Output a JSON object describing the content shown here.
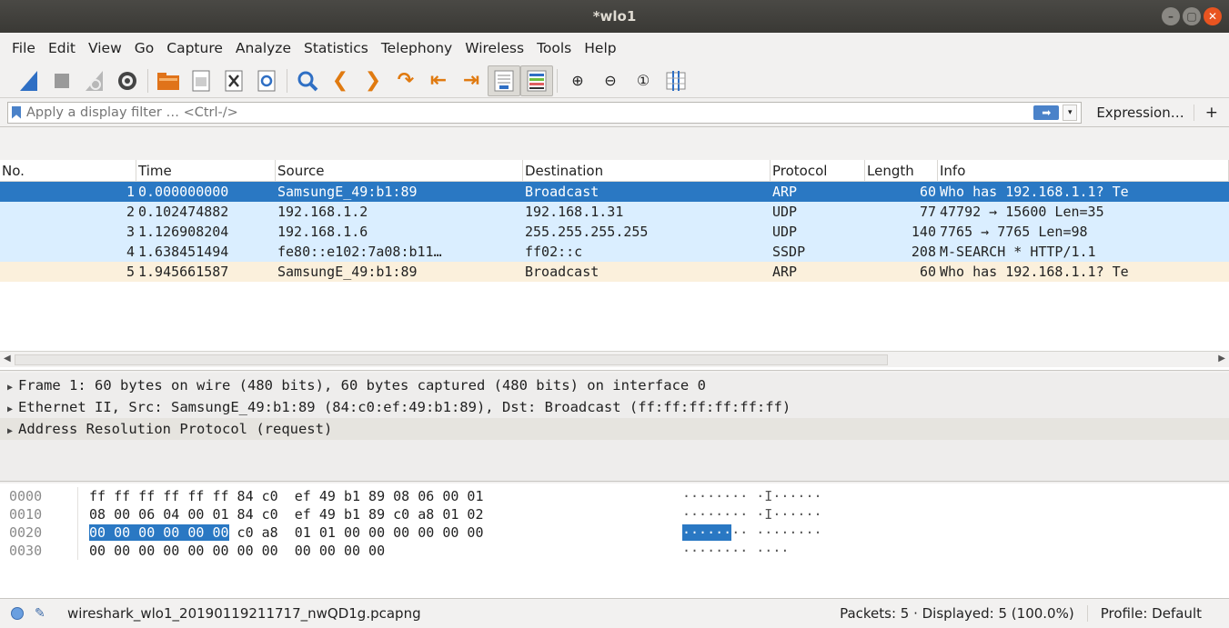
{
  "window": {
    "title": "*wlo1"
  },
  "menu": [
    {
      "label": "File"
    },
    {
      "label": "Edit"
    },
    {
      "label": "View"
    },
    {
      "label": "Go"
    },
    {
      "label": "Capture"
    },
    {
      "label": "Analyze"
    },
    {
      "label": "Statistics"
    },
    {
      "label": "Telephony"
    },
    {
      "label": "Wireless"
    },
    {
      "label": "Tools"
    },
    {
      "label": "Help"
    }
  ],
  "filter": {
    "placeholder": "Apply a display filter … <Ctrl-/>",
    "expression_label": "Expression…",
    "plus_label": "+"
  },
  "packet_list": {
    "columns": [
      "No.",
      "Time",
      "Source",
      "Destination",
      "Protocol",
      "Length",
      "Info"
    ],
    "rows": [
      {
        "no": "1",
        "time": "0.000000000",
        "src": "SamsungE_49:b1:89",
        "dst": "Broadcast",
        "proto": "ARP",
        "len": "60",
        "info": "Who has 192.168.1.1? Te"
      },
      {
        "no": "2",
        "time": "0.102474882",
        "src": "192.168.1.2",
        "dst": "192.168.1.31",
        "proto": "UDP",
        "len": "77",
        "info": "47792 → 15600 Len=35"
      },
      {
        "no": "3",
        "time": "1.126908204",
        "src": "192.168.1.6",
        "dst": "255.255.255.255",
        "proto": "UDP",
        "len": "140",
        "info": "7765 → 7765 Len=98"
      },
      {
        "no": "4",
        "time": "1.638451494",
        "src": "fe80::e102:7a08:b11…",
        "dst": "ff02::c",
        "proto": "SSDP",
        "len": "208",
        "info": "M-SEARCH * HTTP/1.1"
      },
      {
        "no": "5",
        "time": "1.945661587",
        "src": "SamsungE_49:b1:89",
        "dst": "Broadcast",
        "proto": "ARP",
        "len": "60",
        "info": "Who has 192.168.1.1? Te"
      }
    ]
  },
  "details": [
    "Frame 1: 60 bytes on wire (480 bits), 60 bytes captured (480 bits) on interface 0",
    "Ethernet II, Src: SamsungE_49:b1:89 (84:c0:ef:49:b1:89), Dst: Broadcast (ff:ff:ff:ff:ff:ff)",
    "Address Resolution Protocol (request)"
  ],
  "bytes": [
    {
      "offset": "0000",
      "hex_pre": "",
      "hex_hl": "",
      "hex_post": "ff ff ff ff ff ff 84 c0  ef 49 b1 89 08 06 00 01",
      "asc_pre": "",
      "asc_hl": "",
      "asc_post": "········ ·I······"
    },
    {
      "offset": "0010",
      "hex_pre": "",
      "hex_hl": "",
      "hex_post": "08 00 06 04 00 01 84 c0  ef 49 b1 89 c0 a8 01 02",
      "asc_pre": "",
      "asc_hl": "",
      "asc_post": "········ ·I······"
    },
    {
      "offset": "0020",
      "hex_pre": "",
      "hex_hl": "00 00 00 00 00 00",
      "hex_post": " c0 a8  01 01 00 00 00 00 00 00",
      "asc_pre": "",
      "asc_hl": "······",
      "asc_post": "·· ········"
    },
    {
      "offset": "0030",
      "hex_pre": "",
      "hex_hl": "",
      "hex_post": "00 00 00 00 00 00 00 00  00 00 00 00",
      "asc_pre": "",
      "asc_hl": "",
      "asc_post": "········ ····"
    }
  ],
  "status": {
    "file": "wireshark_wlo1_20190119211717_nwQD1g.pcapng",
    "packets": "Packets: 5 · Displayed: 5 (100.0%)",
    "profile": "Profile: Default"
  },
  "colors": {
    "selection": "#2a78c3",
    "udp_row": "#daeeff",
    "arp_row": "#fbf0dc",
    "titlebar": "#3c3b37",
    "close_button": "#e95420"
  }
}
